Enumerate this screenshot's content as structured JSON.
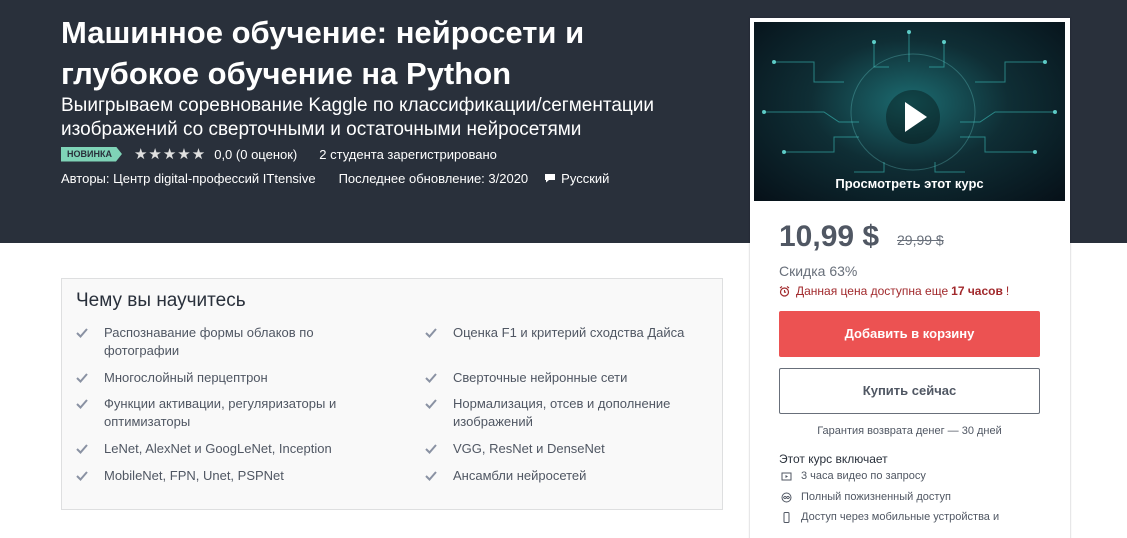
{
  "course": {
    "title": "Машинное обучение: нейросети и глубокое обучение на Python",
    "subtitle": "Выигрываем соревнование Kaggle по классификации/сегментации изображений со сверточными и остаточными нейросетями",
    "badge": "НОВИНКА",
    "stars": "★★★★★",
    "rating": "0,0 (0 оценок)",
    "students": "2 студента зарегистрировано",
    "authors": "Авторы: Центр digital-профессий ITtensive",
    "updated": "Последнее обновление: 3/2020",
    "language": "Русский"
  },
  "learn": {
    "heading": "Чему вы научитесь",
    "items": [
      "Распознавание формы облаков по фотографии",
      "Оценка F1 и критерий сходства Дайса",
      "Многослойный перцептрон",
      "Сверточные нейронные сети",
      "Функции активации, регуляризаторы и оптимизаторы",
      "Нормализация, отсев и дополнение изображений",
      "LeNet, AlexNet и GoogLeNet, Inception",
      "VGG, ResNet и DenseNet",
      "MobileNet, FPN, Unet, PSPNet",
      "Ансамбли нейросетей"
    ]
  },
  "sidebar": {
    "preview_label": "Просмотреть этот курс",
    "price": "10,99 $",
    "old_price": "29,99 $",
    "discount": "Скидка 63%",
    "timer_prefix": "Данная цена доступна еще",
    "timer_hours": "17 часов",
    "timer_suffix": "!",
    "add_to_cart": "Добавить в корзину",
    "buy_now": "Купить сейчас",
    "guarantee": "Гарантия возврата денег — 30 дней",
    "includes_title": "Этот курс включает",
    "includes": [
      "3 часа видео по запросу",
      "Полный пожизненный доступ",
      "Доступ через мобильные устройства и"
    ]
  },
  "colors": {
    "hero_bg": "#29303b",
    "badge": "#7fd3b7",
    "cart_button": "#ec5252",
    "timer_red": "#a1292c"
  },
  "icons": [
    "star-icon",
    "speech-bubble-icon",
    "check-icon",
    "play-icon",
    "alarm-clock-icon",
    "video-icon",
    "infinity-icon",
    "mobile-icon"
  ]
}
